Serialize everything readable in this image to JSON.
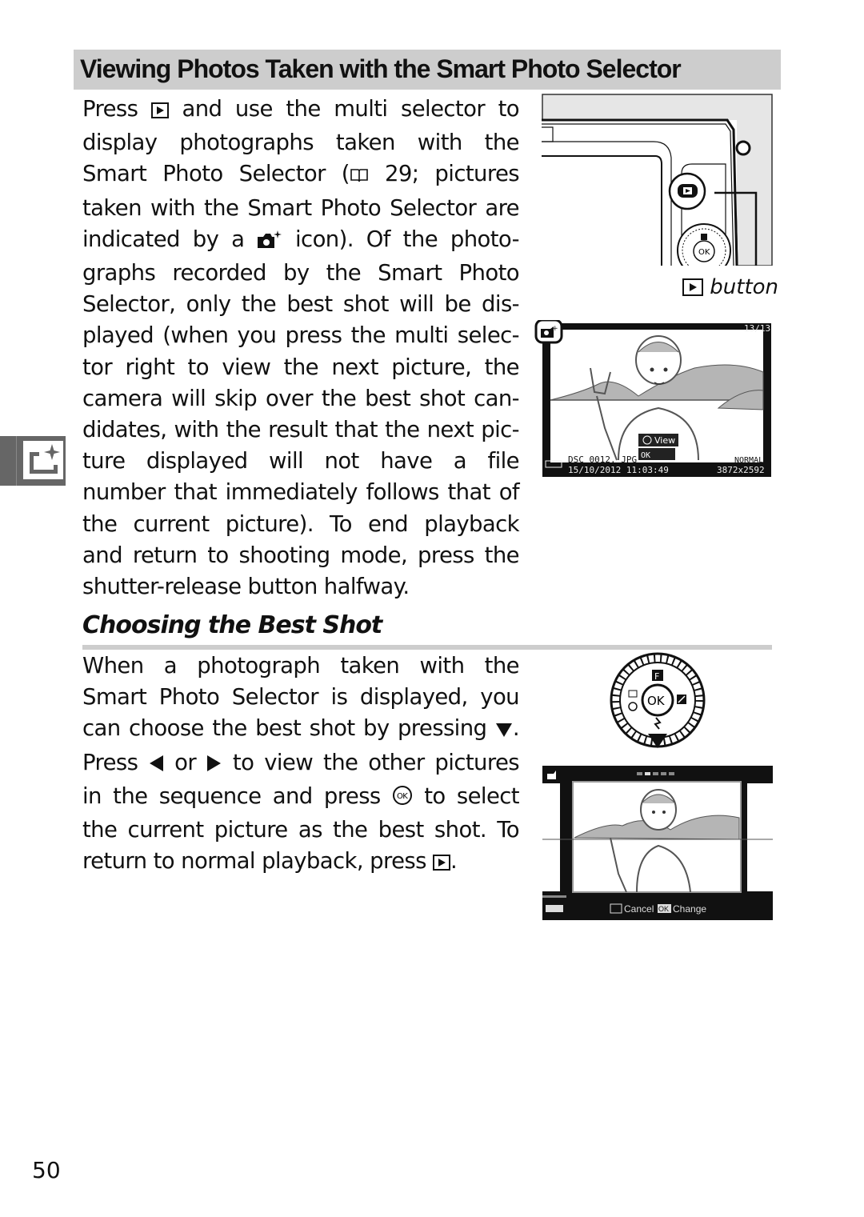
{
  "page": {
    "title": "Viewing Photos Taken with the Smart Photo Selector",
    "page_number": "50",
    "side_tab_icon": "smart-photo-selector-icon"
  },
  "para1": {
    "lines": [
      [
        "Press ",
        "[playback-icon]",
        " and use the multi selector to"
      ],
      [
        "display photographs taken with the"
      ],
      [
        "Smart Photo Selector (",
        "[book-icon]",
        " 29; pictures"
      ],
      [
        "taken with the Smart Photo Selector are"
      ],
      [
        "indicated by a ",
        "[smart-photo-icon]",
        " icon). Of the photo-"
      ],
      [
        "graphs recorded by the Smart Photo"
      ],
      [
        "Selector, only the best shot will be dis-"
      ],
      [
        "played (when you press the multi selec-"
      ],
      [
        "tor right to view the next picture, the"
      ],
      [
        "camera will skip over the best shot can-"
      ],
      [
        "didates, with the result that the next pic-"
      ],
      [
        "ture displayed will not have a file"
      ],
      [
        "number that immediately follows that of"
      ],
      [
        "the current picture). To end playback"
      ],
      [
        "and return to shooting mode, press the"
      ],
      [
        "shutter-release button halfway."
      ]
    ]
  },
  "section2": {
    "heading": "Choosing the Best Shot",
    "lines": [
      [
        "When a photograph taken with the"
      ],
      [
        "Smart Photo Selector is displayed, you"
      ],
      [
        "can choose the best shot by pressing ",
        "[down-arrow-icon]",
        "."
      ],
      [
        "Press ",
        "[left-arrow-icon]",
        " or ",
        "[right-arrow-icon]",
        " to view the other pictures"
      ],
      [
        "in the sequence and press ",
        "[ok-icon]",
        " to select"
      ],
      [
        "the current picture as the best shot. To"
      ],
      [
        "return to normal playback, press ",
        "[playback-icon]",
        "."
      ]
    ]
  },
  "figures": {
    "camera_caption": "button",
    "playback_screen": {
      "counter": "13/13",
      "view_label": "View",
      "ok_label": "OK",
      "filename": "DSC_0012. JPG",
      "datetime": "15/10/2012  11:03:49",
      "quality": "NORMAL",
      "size": "3872x2592"
    },
    "select_screen": {
      "cancel_label": "Cancel",
      "change_label": "Change",
      "ok_label": "OK",
      "sequence_count": 5,
      "current_index": 2
    },
    "dial": {
      "center_label": "OK",
      "top_label": "F"
    }
  },
  "colors": {
    "title_bg": "#cdcdcd",
    "side_tab_bg": "#666666"
  }
}
